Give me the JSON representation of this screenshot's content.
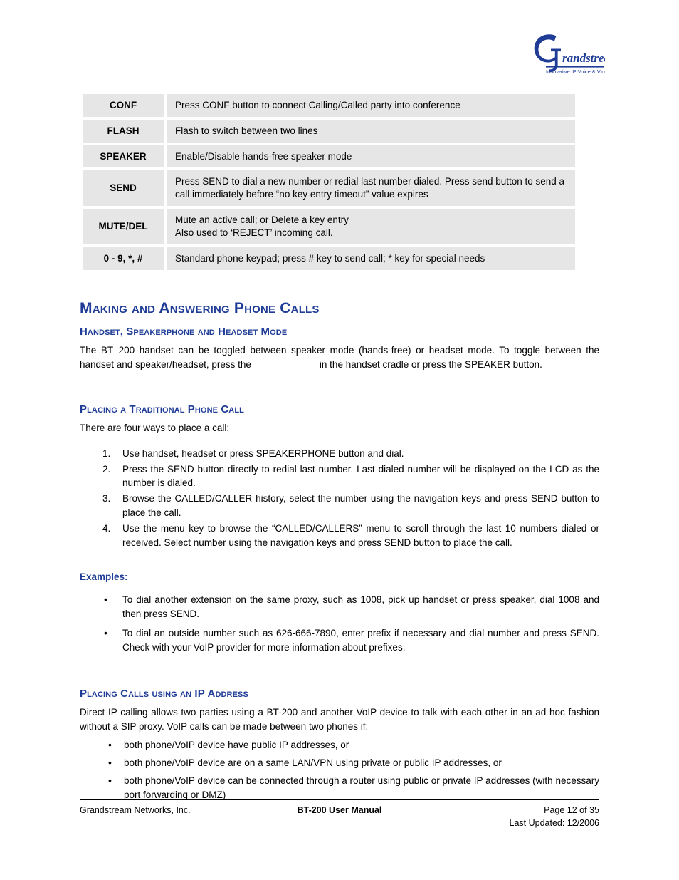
{
  "header": {
    "logo": {
      "name": "grandstream-logo",
      "wordmark": "randstream",
      "initial": "G",
      "tagline": "Innovative IP Voice & Video",
      "color": "#1f3c96"
    }
  },
  "key_table": {
    "rows": [
      {
        "key": "CONF",
        "desc_line1": "Press CONF button to connect Calling/Called party into conference",
        "desc_line2": ""
      },
      {
        "key": "FLASH",
        "desc_line1": "Flash to switch between two lines",
        "desc_line2": ""
      },
      {
        "key": "SPEAKER",
        "desc_line1": "Enable/Disable hands-free speaker mode",
        "desc_line2": ""
      },
      {
        "key": "SEND",
        "desc_line1": "Press SEND to dial a new number or redial last number dialed. Press send button to send a call immediately before “no key entry timeout” value expires",
        "desc_line2": ""
      },
      {
        "key": "MUTE/DEL",
        "desc_line1": "Mute an active call; or Delete a key entry",
        "desc_line2": "Also used to ‘REJECT’ incoming call."
      },
      {
        "key": "0 - 9, *, #",
        "desc_line1": "Standard phone keypad; press # key to send call;  * key for special needs",
        "desc_line2": ""
      }
    ]
  },
  "sections": {
    "main_heading": "Making and Answering Phone Calls",
    "handset_mode": {
      "heading": "Handset, Speakerphone and Headset Mode",
      "paragraph_part1": "The BT–200 handset can be toggled between speaker mode (hands-free) or headset mode. To toggle between the handset and speaker/headset, press the",
      "paragraph_part2": "in the handset cradle or press the SPEAKER button."
    },
    "traditional_call": {
      "heading": "Placing a Traditional Phone Call",
      "intro": "There are four ways to place a call:",
      "steps": [
        "Use handset, headset or press SPEAKERPHONE button and dial.",
        "Press the SEND button directly to redial last number.  Last dialed number will be displayed on the LCD as the number is dialed.",
        "Browse the CALLED/CALLER history, select the number using the navigation keys and press SEND button to place the call.",
        "Use the menu key to browse the “CALLED/CALLERS” menu to scroll through the last 10 numbers dialed or received. Select number using the navigation keys and press SEND button to place the call."
      ]
    },
    "examples": {
      "heading": "Examples:",
      "items": [
        "To dial another extension on the same proxy, such as 1008, pick up handset or press speaker, dial 1008 and then press SEND.",
        "To dial an outside number such as 626-666-7890, enter prefix if necessary and dial number and press SEND.  Check with your VoIP provider for more information about prefixes."
      ]
    },
    "ip_address": {
      "heading_part1": "Placing Calls using an ",
      "heading_ip": "IP",
      "heading_part2": " Address",
      "paragraph": "Direct IP calling allows two parties using a BT-200 and another VoIP device to talk with each other in an ad hoc fashion without a SIP proxy.  VoIP calls can be made between two phones if:",
      "items": [
        "both phone/VoIP device have public IP addresses, or",
        "both phone/VoIP device are on a same LAN/VPN using private or public IP addresses, or",
        "both phone/VoIP device can be connected through a router using public or private IP addresses (with necessary port forwarding or DMZ)"
      ]
    }
  },
  "footer": {
    "company": "Grandstream Networks, Inc.",
    "document_title": "BT-200 User Manual",
    "page_label": "Page 12 of 35",
    "last_updated": "Last Updated:  12/2006"
  }
}
